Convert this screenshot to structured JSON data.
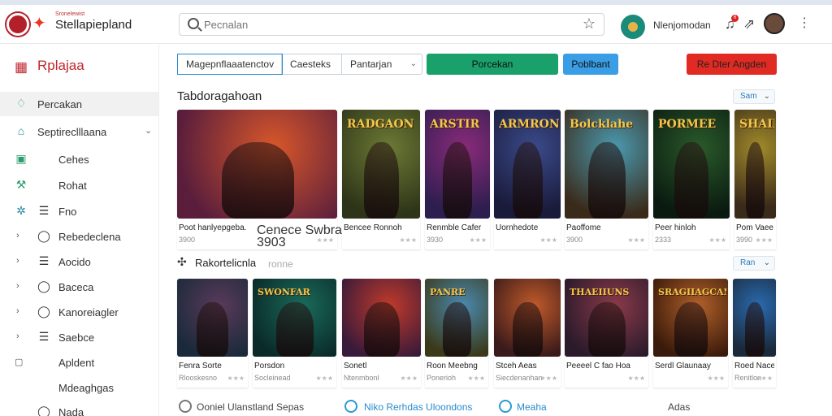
{
  "header": {
    "app_small": "Sronelewist",
    "app_name": "Stellapiepland",
    "search_placeholder": "Pecnalan",
    "user_name": "Nlenjomodan",
    "notification_count": "6"
  },
  "sidebar": {
    "brand": "Rplajaa",
    "items": [
      {
        "label": "Percakan",
        "icon": "leaf-icon"
      },
      {
        "label": "Septireclllaana",
        "icon": "home-icon"
      },
      {
        "label": "Cehes",
        "icon": "gamepad-icon"
      },
      {
        "label": "Rohat",
        "icon": "wrench-icon"
      },
      {
        "label": "Fno",
        "icon": "list-icon"
      },
      {
        "label": "Rebedeclena",
        "icon": "chat-icon"
      },
      {
        "label": "Aocido",
        "icon": "list-icon"
      },
      {
        "label": "Baceca",
        "icon": "chat-icon"
      },
      {
        "label": "Kanoreiagler",
        "icon": "chat-icon"
      },
      {
        "label": "Saebce",
        "icon": "list-icon"
      },
      {
        "label": "Apldent",
        "icon": "square-icon"
      },
      {
        "label": "Mdeaghgas",
        "icon": "none"
      },
      {
        "label": "Nada",
        "icon": "circle-icon"
      }
    ]
  },
  "toolbar": {
    "tabs": [
      "Magepnflaaatenctov",
      "Caesteks",
      "Pantarjan"
    ],
    "green_button": "Porcekan",
    "blue_button": "Poblbant",
    "red_button": "Re Dter Angden"
  },
  "section1": {
    "title": "Tabdoragahoan",
    "sort": "Sam",
    "cards": [
      {
        "title_art": "",
        "name": "Poot hanlyepgeba.",
        "sub": "3900",
        "colors": [
          "#d9572a",
          "#5a1e3c"
        ]
      },
      {
        "title_art": "",
        "name": "Cenece Swbraoh",
        "sub": "3903",
        "colors": [
          "#8c3a1c",
          "#2b1a3a"
        ]
      },
      {
        "title_art": "RADGAON",
        "name": "Bencee Ronnoh",
        "sub": "",
        "colors": [
          "#6b7a35",
          "#2e3418"
        ]
      },
      {
        "title_art": "ARSTIR",
        "name": "Renmble Cafer",
        "sub": "3930",
        "colors": [
          "#8a2a7a",
          "#2c1e4e"
        ]
      },
      {
        "title_art": "ARMRON",
        "name": "Uornhedote",
        "sub": "",
        "colors": [
          "#3a4a8a",
          "#1a1a3a"
        ]
      },
      {
        "title_art": "Bolcklahe",
        "name": "Paoffome",
        "sub": "3900",
        "colors": [
          "#4a9ab0",
          "#3a2a1a"
        ]
      },
      {
        "title_art": "PORMEE",
        "name": "Peer hinloh",
        "sub": "2333",
        "colors": [
          "#2a5a2a",
          "#0a1a10"
        ]
      },
      {
        "title_art": "SHAIR",
        "name": "Pom Vaee",
        "sub": "3990",
        "colors": [
          "#a08a2a",
          "#3a2a1a"
        ]
      }
    ]
  },
  "section2": {
    "title": "Rakortelicnla",
    "subtitle": "ronne",
    "sort": "Ran",
    "cards": [
      {
        "title_art": "",
        "name": "Fenra Sorte",
        "sub": "Rlooskesno",
        "colors": [
          "#5a3a5a",
          "#1a2a3a"
        ]
      },
      {
        "title_art": "SWONFAR",
        "name": "Porsdon",
        "sub": "Socleinead",
        "colors": [
          "#1a6a5a",
          "#0a2a2a"
        ]
      },
      {
        "title_art": "",
        "name": "Sonetl",
        "sub": "Ntenmbonl",
        "colors": [
          "#c03a2a",
          "#3a1a3a"
        ]
      },
      {
        "title_art": "PANRE",
        "name": "Roon Meebng",
        "sub": "Ponerioh",
        "colors": [
          "#4a8ab0",
          "#3a3a1a"
        ]
      },
      {
        "title_art": "",
        "name": "Stceh Aeas",
        "sub": "Siecdenanhan",
        "colors": [
          "#c05a2a",
          "#3a1a1a"
        ]
      },
      {
        "title_art": "THAEIIUNS",
        "name": "Peeeel C fao Hoa",
        "sub": "",
        "colors": [
          "#8a3a4a",
          "#2a1a2a"
        ]
      },
      {
        "title_art": "SRAGIIAGCAN",
        "name": "Serdl Glaunaay",
        "sub": "",
        "colors": [
          "#b0602a",
          "#3a1a0a"
        ]
      },
      {
        "title_art": "",
        "name": "Roed Nace",
        "sub": "Renitlon",
        "colors": [
          "#2a6ab0",
          "#1a2a3a"
        ]
      }
    ]
  },
  "bottom_links": [
    "Ooniel Ulanstland Sepas",
    "Niko Rerhdas Uloondons",
    "Meaha",
    "Adas"
  ]
}
